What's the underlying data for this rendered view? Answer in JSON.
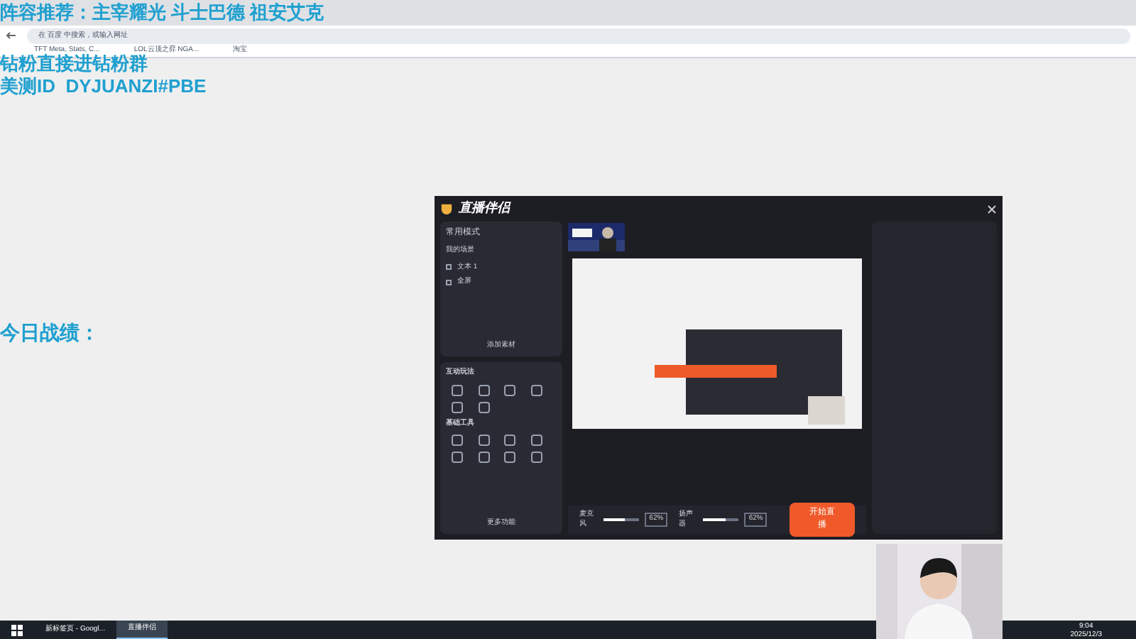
{
  "overlay": {
    "lines": [
      "阵容推荐：主宰耀光 斗士巴德 祖安艾克",
      "钻粉直接进钻粉群",
      "美测ID  DYJUANZI#PBE"
    ],
    "today": "今日战绩："
  },
  "browser": {
    "address_placeholder": "在 百度 中搜索，或输入网址",
    "bookmarks": [
      "TFT Meta, Stats, C...",
      "LOL云顶之弈 NGA...",
      "淘宝"
    ]
  },
  "app": {
    "title": "直播伴侣",
    "mode": "常用模式",
    "scene_tab": "我的场景",
    "sources": [
      {
        "label": "文本 1",
        "checked": false
      },
      {
        "label": "全屏",
        "checked": false
      }
    ],
    "add_source": "添加素材",
    "sections": [
      {
        "title": "互动玩法"
      },
      {
        "title": "基础工具"
      }
    ],
    "more": "更多功能",
    "mic": {
      "label": "麦克风",
      "level": 0.62,
      "reading": "62%"
    },
    "speaker": {
      "label": "扬声器",
      "level": 0.62,
      "reading": "62%"
    },
    "start": "开始直播"
  },
  "taskbar": {
    "items": [
      {
        "label": "新标签页 - Googl...",
        "selected": false
      },
      {
        "label": "直播伴侣",
        "selected": true
      }
    ],
    "time": "9:04",
    "date": "2025/12/3"
  }
}
